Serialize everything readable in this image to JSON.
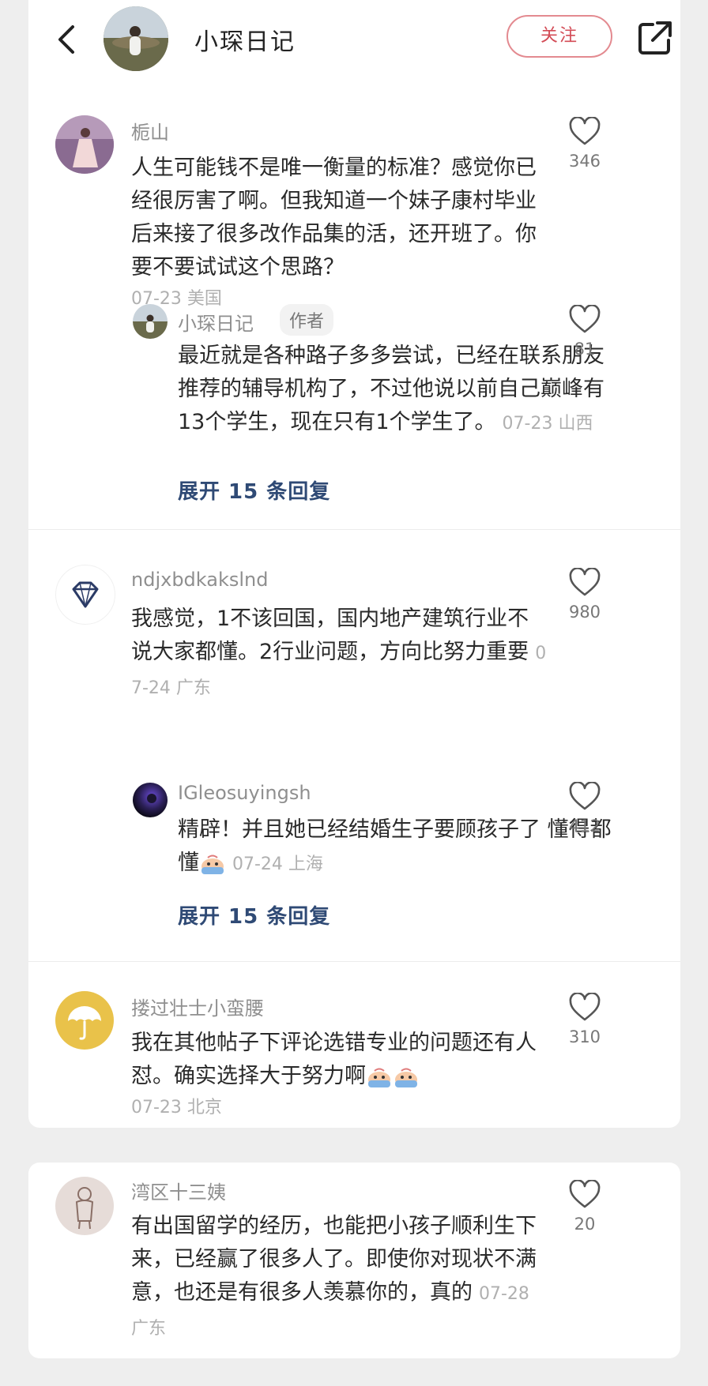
{
  "header": {
    "title": "小琛日记",
    "follow_label": "关注"
  },
  "comments": [
    {
      "username": "栀山",
      "text": "人生可能钱不是唯一衡量的标准？感觉你已经很厉害了啊。但我知道一个妹子康村毕业后来接了很多改作品集的活，还开班了。你要不要试试这个思路？",
      "meta": "07-23 美国",
      "likes": "346",
      "reply": {
        "username": "小琛日记",
        "badge": "作者",
        "text": "最近就是各种路子多多尝试，已经在联系朋友推荐的辅导机构了，不过他说以前自己巅峰有13个学生，现在只有1个学生了。",
        "meta": "07-23 山西",
        "likes": "81"
      },
      "expand_label": "展开 15 条回复"
    },
    {
      "username": "ndjxbdkakslnd",
      "text": "我感觉，1不该回国，国内地产建筑行业不说大家都懂。2行业问题，方向比努力重要",
      "meta": "07-24 广东",
      "likes": "980",
      "reply": {
        "username": "IGleosuyingsh",
        "text": "精辟！并且她已经结婚生子要顾孩子了 懂得都懂",
        "meta": "07-24 上海",
        "likes": "412"
      },
      "expand_label": "展开 15 条回复"
    },
    {
      "username": "搂过壮士小蛮腰",
      "text": "我在其他帖子下评论选错专业的问题还有人怼。确实选择大于努力啊",
      "meta": "07-23 北京",
      "likes": "310"
    },
    {
      "username": "湾区十三姨",
      "text": "有出国留学的经历，也能把小孩子顺利生下来，已经赢了很多人了。即使你对现状不满意，也还是有很多人羡慕你的，真的",
      "meta": "07-28 广东",
      "likes": "20"
    }
  ],
  "colors": {
    "accent": "#d34c57",
    "link": "#2f4a75",
    "background": "#eeeeee"
  }
}
